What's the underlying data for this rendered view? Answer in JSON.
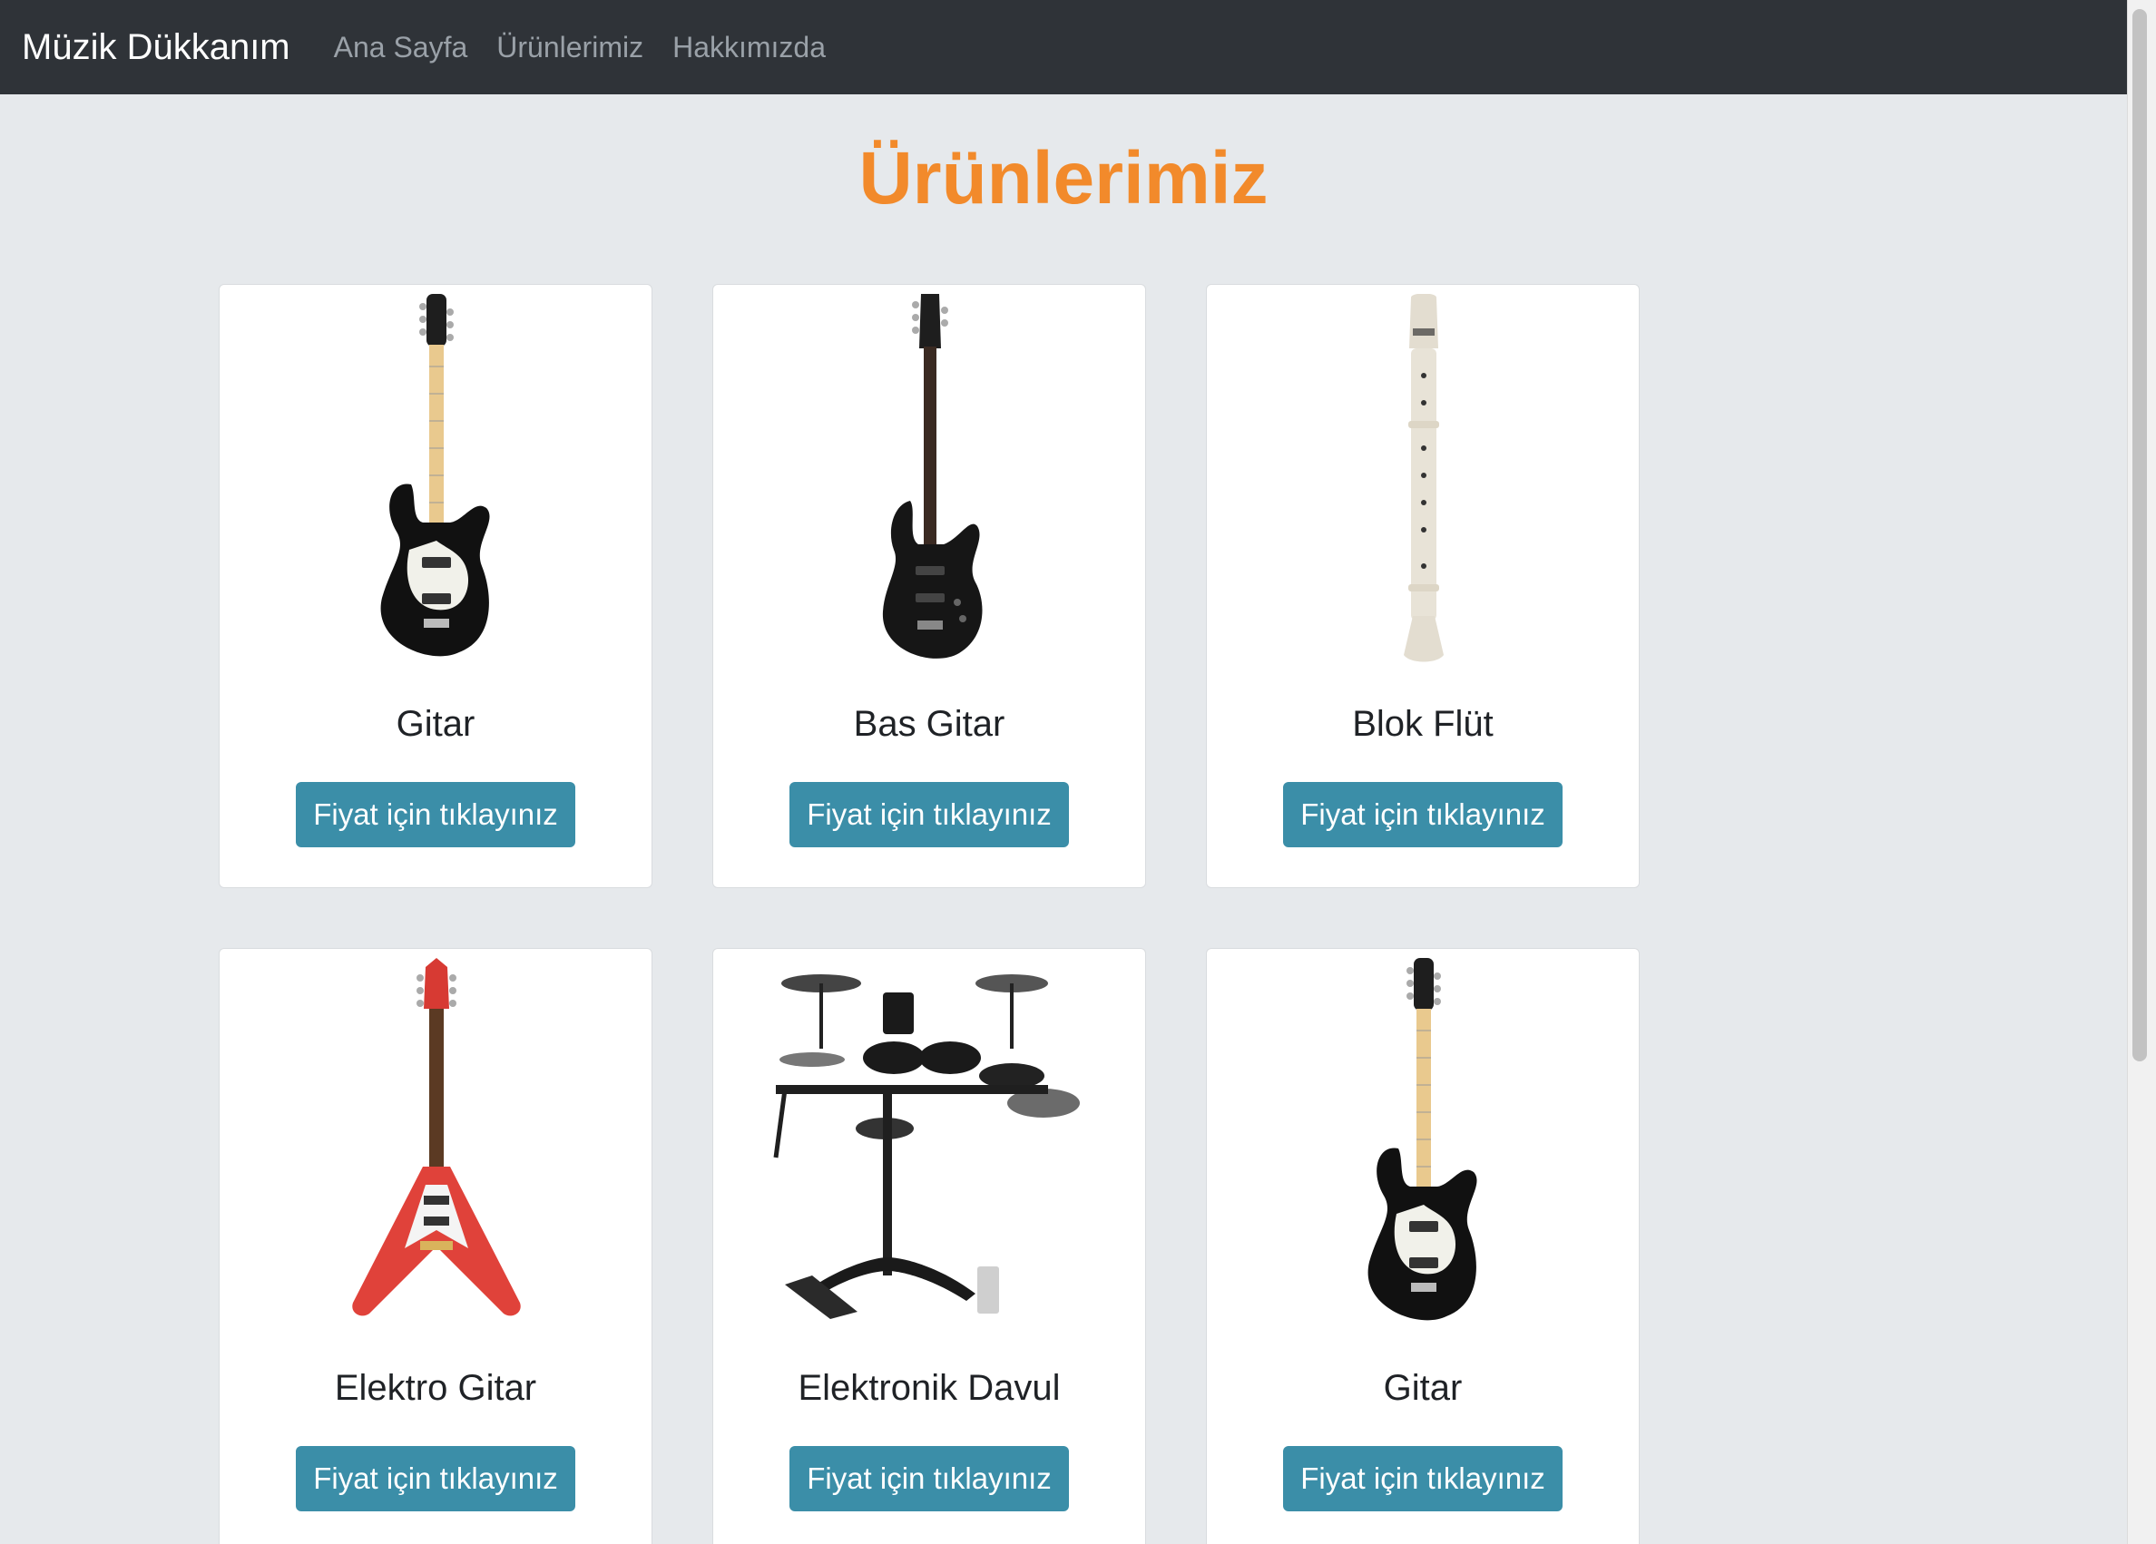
{
  "navbar": {
    "brand": "Müzik Dükkanım",
    "links": [
      "Ana Sayfa",
      "Ürünlerimiz",
      "Hakkımızda"
    ]
  },
  "page": {
    "title": "Ürünlerimiz"
  },
  "products": [
    {
      "name": "Gitar",
      "button_label": "Fiyat için tıklayınız",
      "image_icon": "electric-guitar-image"
    },
    {
      "name": "Bas Gitar",
      "button_label": "Fiyat için tıklayınız",
      "image_icon": "bass-guitar-image"
    },
    {
      "name": "Blok Flüt",
      "button_label": "Fiyat için tıklayınız",
      "image_icon": "recorder-flute-image"
    },
    {
      "name": "Elektro Gitar",
      "button_label": "Fiyat için tıklayınız",
      "image_icon": "flying-v-guitar-image"
    },
    {
      "name": "Elektronik Davul",
      "button_label": "Fiyat için tıklayınız",
      "image_icon": "electronic-drum-kit-image"
    },
    {
      "name": "Gitar",
      "button_label": "Fiyat için tıklayınız",
      "image_icon": "electric-guitar-image"
    }
  ],
  "colors": {
    "navbar_bg": "#2f3338",
    "page_bg": "#e6e9ec",
    "title": "#f28a2b",
    "button": "#3b8ea8"
  }
}
